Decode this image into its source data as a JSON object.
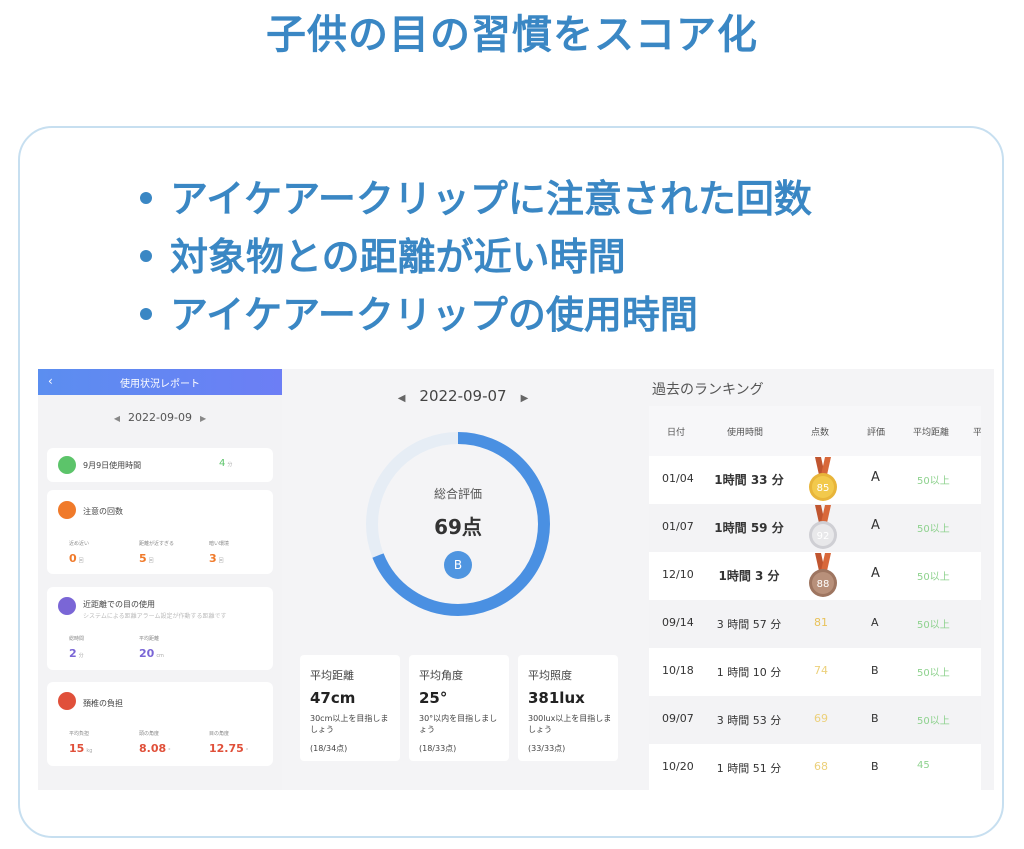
{
  "page": {
    "title": "子供の目の習慣をスコア化",
    "bullets": [
      "アイケアークリップに注意された回数",
      "対象物との距離が近い時間",
      "アイケアークリップの使用時間"
    ]
  },
  "left_panel": {
    "header": "使用状況レポート",
    "back_icon": "chevron-left-icon",
    "date": "2022-09-09",
    "usage": {
      "label": "9月9日使用時間",
      "value": "4",
      "unit": "分"
    },
    "warnings": {
      "title": "注意の回数",
      "items": [
        {
          "label": "近め近い",
          "value": "0",
          "unit": "回"
        },
        {
          "label": "距離が近すぎる",
          "value": "5",
          "unit": "回"
        },
        {
          "label": "暗い環境",
          "value": "3",
          "unit": "回"
        }
      ]
    },
    "close_use": {
      "title": "近距離での目の使用",
      "subtitle": "システムによる距離アラーム設定が作動する距離です",
      "items": [
        {
          "label": "総時間",
          "value": "2",
          "unit": "分"
        },
        {
          "label": "平均距離",
          "value": "20",
          "unit": "cm"
        }
      ]
    },
    "neck": {
      "title": "頚椎の負担",
      "items": [
        {
          "label": "平均負担",
          "value": "15",
          "unit": "kg"
        },
        {
          "label": "頭の角度",
          "value": "8.08",
          "unit": "°"
        },
        {
          "label": "目の角度",
          "value": "12.75",
          "unit": "°"
        }
      ]
    }
  },
  "middle": {
    "date": "2022-09-07",
    "overall_label": "総合評価",
    "score_text": "69点",
    "score_fraction": 0.69,
    "grade": "B",
    "metrics": [
      {
        "title": "平均距離",
        "value": "47cm",
        "desc": "30cm以上を目指しましょう",
        "points": "(18/34点)"
      },
      {
        "title": "平均角度",
        "value": "25°",
        "desc": "30°以内を目指しましょう",
        "points": "(18/33点)"
      },
      {
        "title": "平均照度",
        "value": "381lux",
        "desc": "300lux以上を目指しましょう",
        "points": "(33/33点)"
      }
    ]
  },
  "ranking": {
    "title": "過去のランキング",
    "columns": [
      "日付",
      "使用時間",
      "点数",
      "評価",
      "平均距離",
      "平"
    ],
    "rows": [
      {
        "date": "01/04",
        "time": "1時間 33 分",
        "score": "85",
        "grade": "A",
        "dist": "50以上",
        "medal": "gold"
      },
      {
        "date": "01/07",
        "time": "1時間 59 分",
        "score": "92",
        "grade": "A",
        "dist": "50以上",
        "medal": "silver"
      },
      {
        "date": "12/10",
        "time": "1時間 3 分",
        "score": "88",
        "grade": "A",
        "dist": "50以上",
        "medal": "bronze"
      },
      {
        "date": "09/14",
        "time": "3 時間 57 分",
        "score": "81",
        "grade": "A",
        "dist": "50以上"
      },
      {
        "date": "10/18",
        "time": "1 時間 10 分",
        "score": "74",
        "grade": "B",
        "dist": "50以上"
      },
      {
        "date": "09/07",
        "time": "3 時間 53 分",
        "score": "69",
        "grade": "B",
        "dist": "50以上"
      },
      {
        "date": "10/20",
        "time": "1 時間 51 分",
        "score": "68",
        "grade": "B",
        "dist": "45"
      }
    ]
  },
  "colors": {
    "title_blue": "#3a87c4",
    "accent_blue": "#4a90e2",
    "green": "#5cc46a",
    "orange": "#f07a2a",
    "purple": "#7a66d6",
    "red": "#e0503a"
  }
}
